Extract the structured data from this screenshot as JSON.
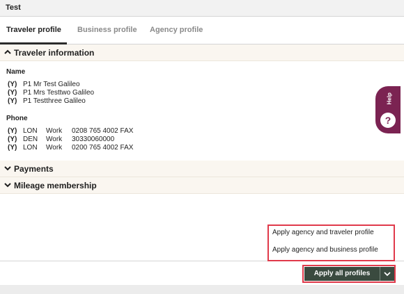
{
  "window": {
    "title": "Test"
  },
  "tabs": [
    {
      "label": "Traveler profile",
      "active": true
    },
    {
      "label": "Business profile",
      "active": false
    },
    {
      "label": "Agency profile",
      "active": false
    }
  ],
  "sections": {
    "traveler_information": {
      "label": "Traveler information",
      "expanded": true
    },
    "payments": {
      "label": "Payments",
      "expanded": false
    },
    "mileage_membership": {
      "label": "Mileage membership",
      "expanded": false
    }
  },
  "name": {
    "label": "Name",
    "rows": [
      {
        "flag": "(Y)",
        "value": "P1 Mr Test Galileo"
      },
      {
        "flag": "(Y)",
        "value": "P1 Mrs Testtwo Galileo"
      },
      {
        "flag": "(Y)",
        "value": "P1 Testthree Galileo"
      }
    ]
  },
  "phone": {
    "label": "Phone",
    "rows": [
      {
        "flag": "(Y)",
        "city": "LON",
        "type": "Work",
        "number": "0208 765 4002 FAX"
      },
      {
        "flag": "(Y)",
        "city": "DEN",
        "type": "Work",
        "number": "30330060000"
      },
      {
        "flag": "(Y)",
        "city": "LON",
        "type": "Work",
        "number": "0200 765 4002 FAX"
      }
    ]
  },
  "help": {
    "label": "Help",
    "icon": "question-icon"
  },
  "apply_menu": {
    "items": [
      "Apply agency and traveler profile",
      "Apply agency and business profile"
    ]
  },
  "apply_button": {
    "label": "Apply all profiles"
  },
  "colors": {
    "button_bg": "#3a4a3f",
    "help_bg": "#7b2352",
    "highlight": "#e0394a",
    "section_bg": "#faf6f0"
  }
}
